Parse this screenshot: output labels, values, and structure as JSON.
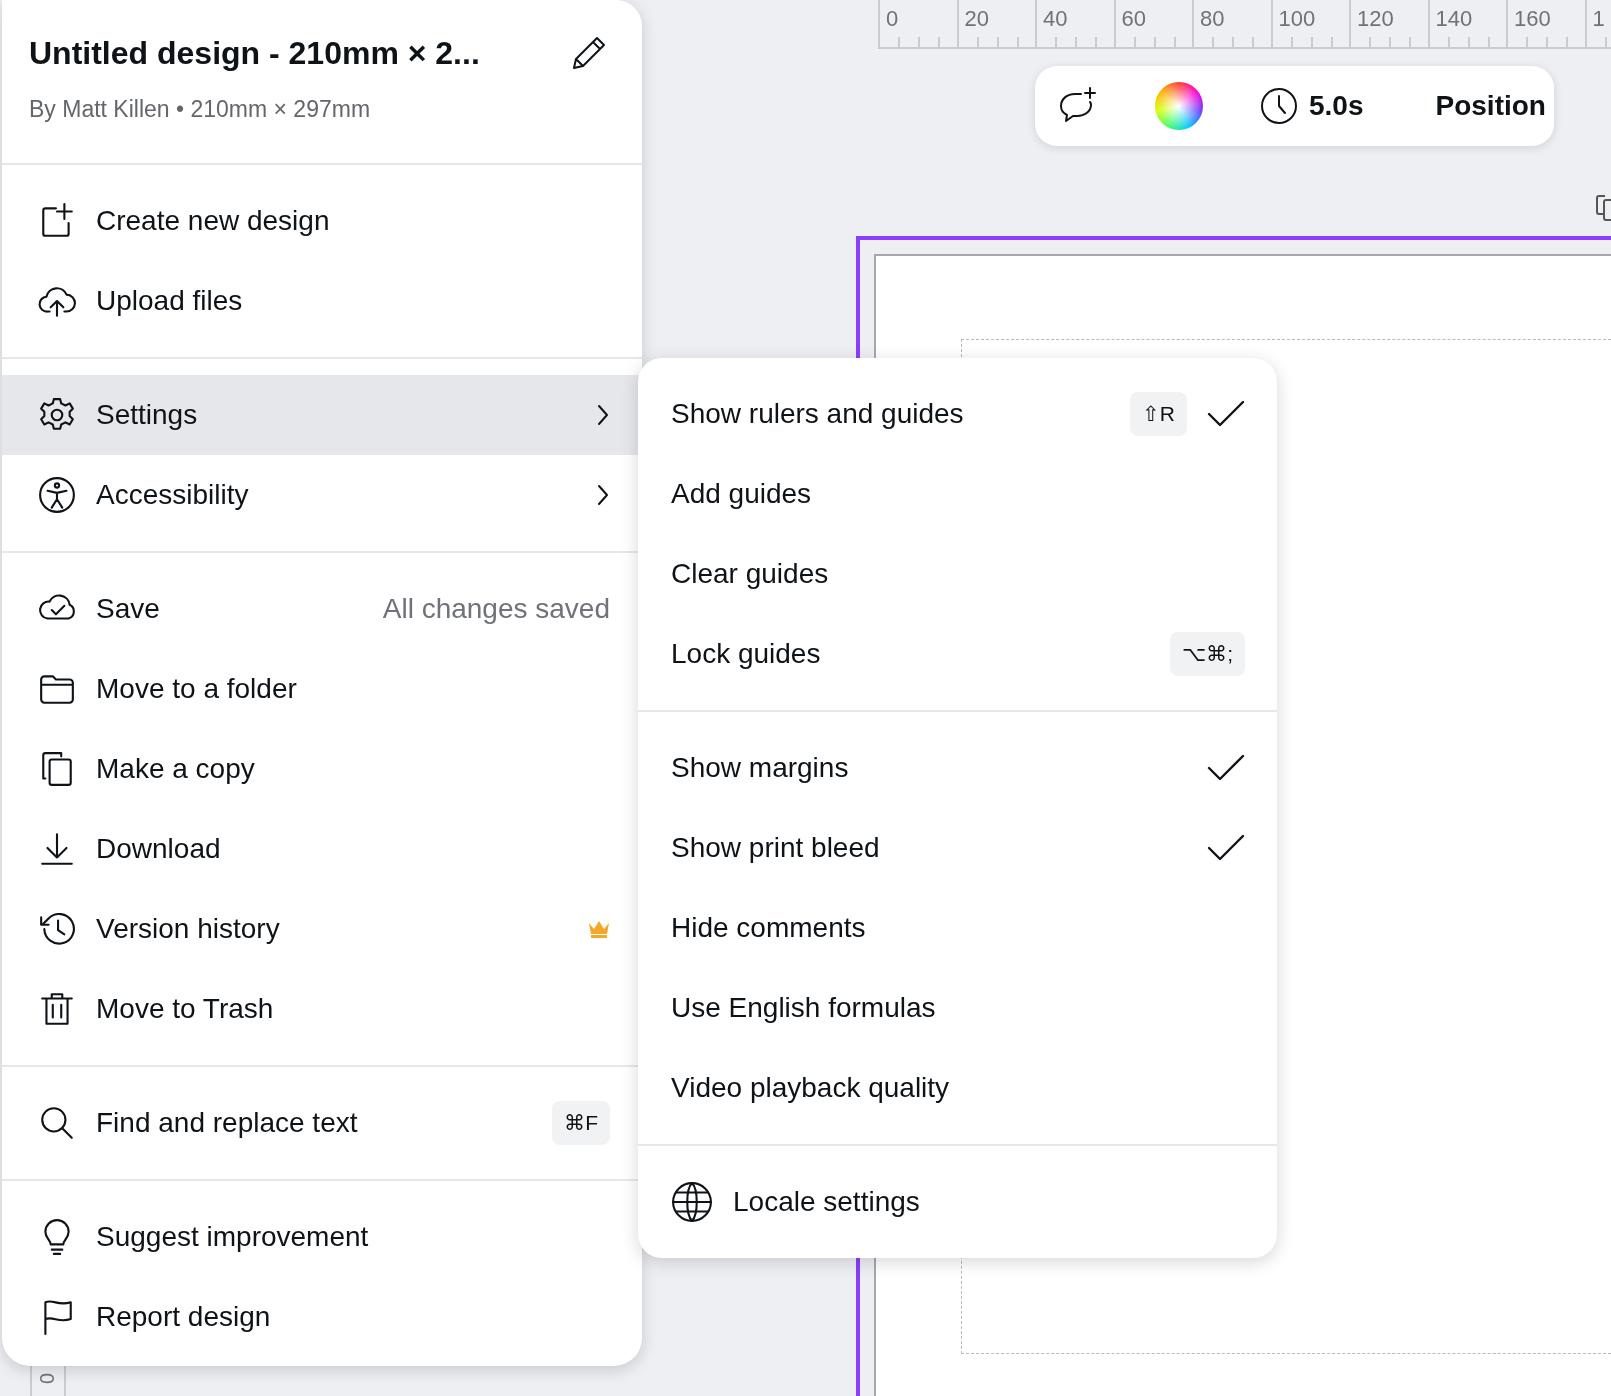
{
  "ruler": {
    "top_labels": [
      "0",
      "20",
      "40",
      "60",
      "80",
      "100",
      "120",
      "140",
      "160",
      "1"
    ],
    "left_labels": [
      "0"
    ]
  },
  "toolbar": {
    "duration": "5.0s",
    "position_button": "Position"
  },
  "menu": {
    "title": "Untitled design - 210mm × 2...",
    "subtitle": "By Matt Killen • 210mm × 297mm",
    "sections": [
      [
        {
          "label": "Create new design",
          "selected": false,
          "has_submenu": false
        },
        {
          "label": "Upload files",
          "selected": false,
          "has_submenu": false
        }
      ],
      [
        {
          "label": "Settings",
          "selected": true,
          "has_submenu": true
        },
        {
          "label": "Accessibility",
          "selected": false,
          "has_submenu": true
        }
      ],
      [
        {
          "label": "Save",
          "status": "All changes saved",
          "selected": false,
          "has_submenu": false
        },
        {
          "label": "Move to a folder",
          "selected": false,
          "has_submenu": false
        },
        {
          "label": "Make a copy",
          "selected": false,
          "has_submenu": false
        },
        {
          "label": "Download",
          "selected": false,
          "has_submenu": false
        },
        {
          "label": "Version history",
          "premium": true,
          "selected": false,
          "has_submenu": false
        },
        {
          "label": "Move to Trash",
          "selected": false,
          "has_submenu": false
        }
      ],
      [
        {
          "label": "Find and replace text",
          "shortcut": "⌘F",
          "selected": false,
          "has_submenu": false
        }
      ],
      [
        {
          "label": "Suggest improvement",
          "selected": false,
          "has_submenu": false
        },
        {
          "label": "Report design",
          "selected": false,
          "has_submenu": false
        }
      ]
    ]
  },
  "submenu": {
    "sections": [
      [
        {
          "kind": "toggle",
          "label": "Show rulers and guides",
          "shortcut": "⇧R",
          "checked": true
        },
        {
          "kind": "action",
          "label": "Add guides"
        },
        {
          "kind": "action",
          "label": "Clear guides"
        },
        {
          "kind": "action",
          "label": "Lock guides",
          "shortcut": "⌥⌘;"
        }
      ],
      [
        {
          "kind": "toggle",
          "label": "Show margins",
          "checked": true
        },
        {
          "kind": "toggle",
          "label": "Show print bleed",
          "checked": true
        },
        {
          "kind": "toggle",
          "label": "Hide comments",
          "checked": false
        },
        {
          "kind": "toggle",
          "label": "Use English formulas",
          "checked": false
        },
        {
          "kind": "action",
          "label": "Video playback quality"
        }
      ],
      [
        {
          "kind": "link",
          "label": "Locale settings"
        }
      ]
    ]
  }
}
